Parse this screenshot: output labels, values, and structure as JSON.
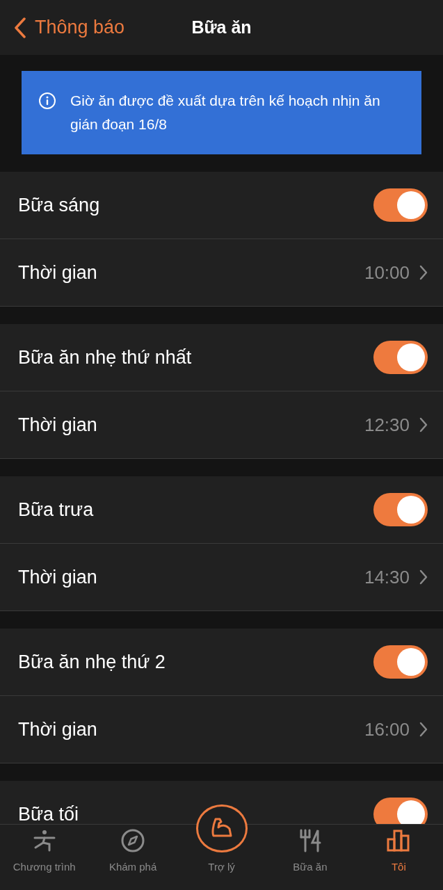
{
  "header": {
    "back_label": "Thông báo",
    "title": "Bữa ăn"
  },
  "info_banner": {
    "text": "Giờ ăn được đề xuất dựa trên kế hoạch nhịn ăn gián đoạn 16/8"
  },
  "meals": [
    {
      "name": "Bữa sáng",
      "on": true,
      "time_label": "Thời gian",
      "time": "10:00"
    },
    {
      "name": "Bữa ăn nhẹ thứ nhất",
      "on": true,
      "time_label": "Thời gian",
      "time": "12:30"
    },
    {
      "name": "Bữa trưa",
      "on": true,
      "time_label": "Thời gian",
      "time": "14:30"
    },
    {
      "name": "Bữa ăn nhẹ thứ 2",
      "on": true,
      "time_label": "Thời gian",
      "time": "16:00"
    },
    {
      "name": "Bữa tối",
      "on": true
    }
  ],
  "tab_bar": [
    {
      "label": "Chương trình",
      "kind": "exercise",
      "selected": false
    },
    {
      "label": "Khám phá",
      "kind": "compass",
      "selected": false
    },
    {
      "label": "Trợ lý",
      "kind": "assistant",
      "selected": false
    },
    {
      "label": "Bữa ăn",
      "kind": "cutlery",
      "selected": false
    },
    {
      "label": "Tôi",
      "kind": "chart",
      "selected": true
    }
  ]
}
